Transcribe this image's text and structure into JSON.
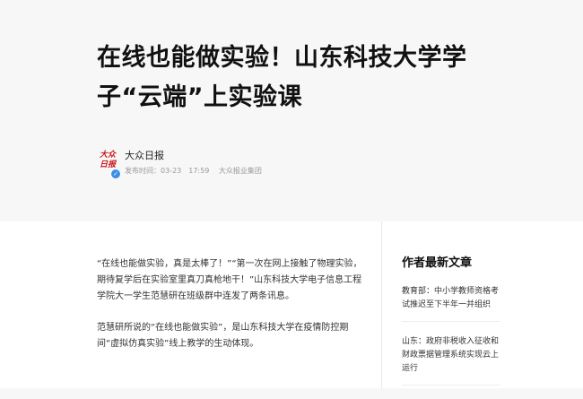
{
  "article": {
    "title": "在线也能做实验！山东科技大学学子“云端”上实验课",
    "author": "大众日报",
    "avatar_text": "大众日报",
    "publish_time": "发布时间：03-23　17:59",
    "source": "大众报业集团",
    "paragraphs": [
      "“在线也能做实验，真是太棒了！”“第一次在网上接触了物理实验，期待复学后在实验室里真刀真枪地干！”山东科技大学电子信息工程学院大一学生范慧研在班级群中连发了两条讯息。",
      "范慧研所说的“在线也能做实验”，是山东科技大学在疫情防控期间“虚拟仿真实验”线上教学的生动体现。"
    ]
  },
  "sidebar": {
    "title": "作者最新文章",
    "items": [
      {
        "text": "教育部：中小学教师资格考试推迟至下半年一并组织"
      },
      {
        "text": "山东：政府非税收入征收和财政票据管理系统实现云上运行"
      }
    ]
  },
  "colors": {
    "brand_red": "#c8161d",
    "verified_blue": "#3a8ee6"
  },
  "icons": {
    "verified": "verified-badge-icon"
  }
}
